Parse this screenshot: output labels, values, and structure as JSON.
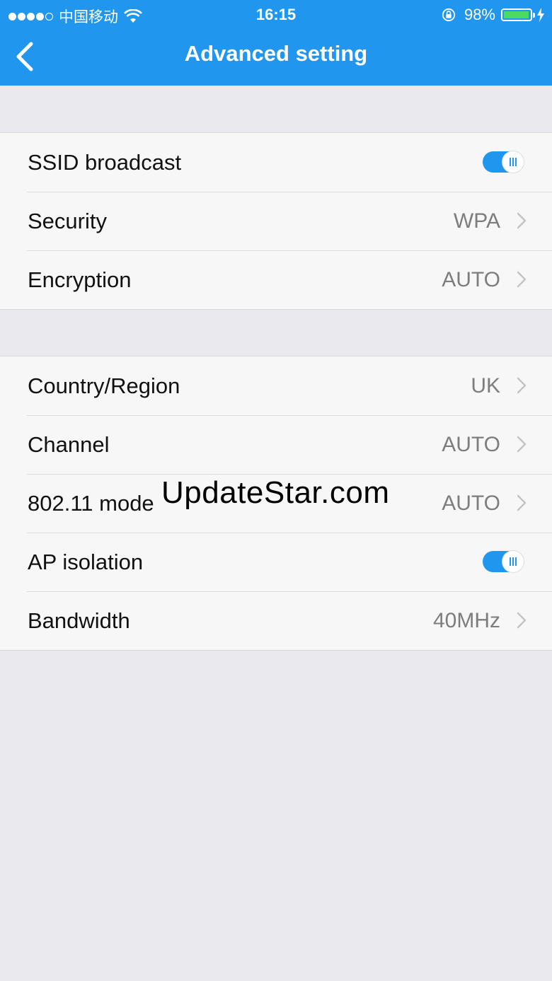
{
  "status_bar": {
    "carrier": "中国移动",
    "time": "16:15",
    "battery_percent": "98%",
    "battery_level": 0.98,
    "signal_strength": 4,
    "signal_max": 5
  },
  "header": {
    "title": "Advanced setting"
  },
  "groups": [
    {
      "rows": [
        {
          "label": "SSID broadcast",
          "type": "toggle",
          "on": true
        },
        {
          "label": "Security",
          "type": "value",
          "value": "WPA"
        },
        {
          "label": "Encryption",
          "type": "value",
          "value": "AUTO"
        }
      ]
    },
    {
      "rows": [
        {
          "label": "Country/Region",
          "type": "value",
          "value": "UK"
        },
        {
          "label": "Channel",
          "type": "value",
          "value": "AUTO"
        },
        {
          "label": "802.11 mode",
          "type": "value",
          "value": "AUTO"
        },
        {
          "label": "AP isolation",
          "type": "toggle",
          "on": true
        },
        {
          "label": "Bandwidth",
          "type": "value",
          "value": "40MHz"
        }
      ]
    }
  ],
  "watermark": "UpdateStar.com",
  "colors": {
    "accent": "#2196ee",
    "background": "#e9e9ee",
    "battery": "#4cd964"
  }
}
